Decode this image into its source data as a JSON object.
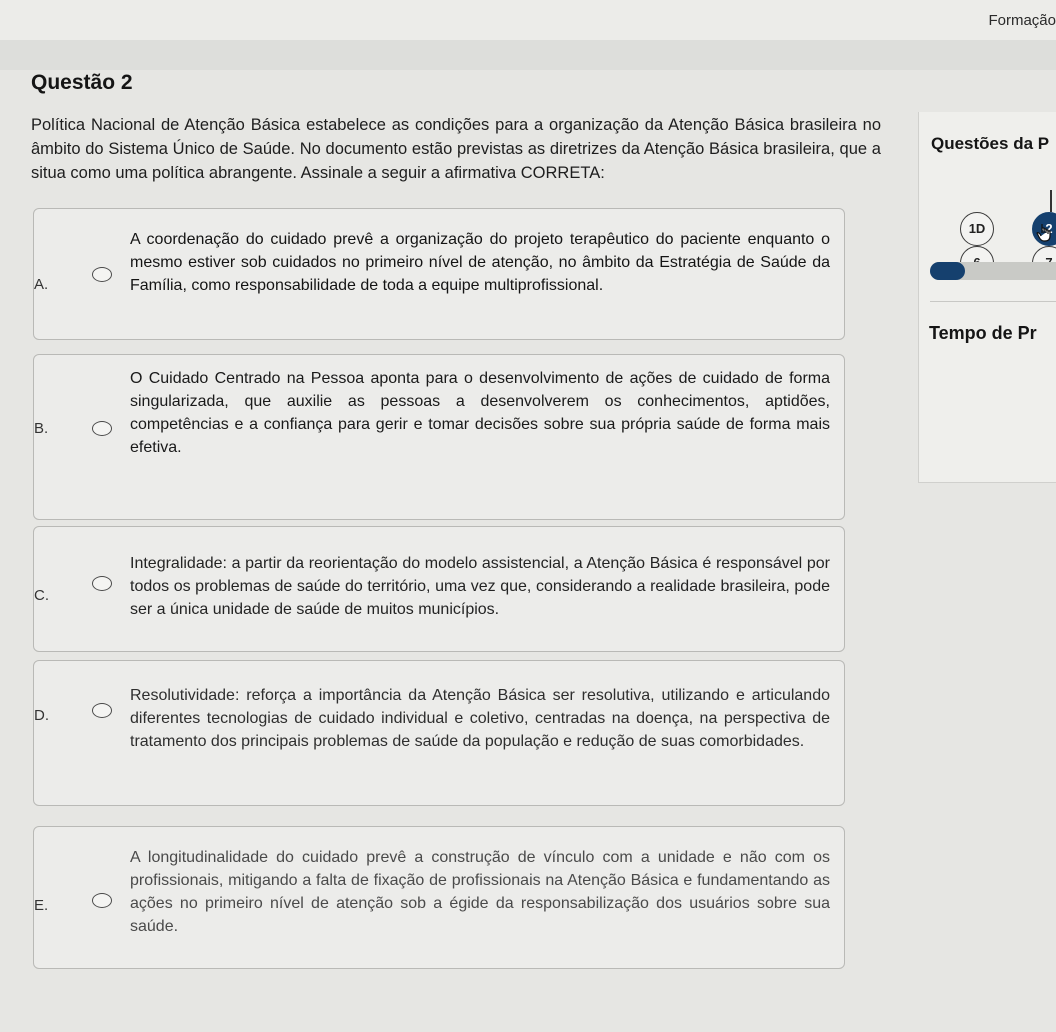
{
  "header": {
    "label": "Formação"
  },
  "question": {
    "title": "Questão 2",
    "text": "Política Nacional de Atenção Básica estabelece as condições para a organização da Atenção Básica brasileira no âmbito do Sistema Único de Saúde. No documento estão previstas as diretrizes da Atenção Básica brasileira, que a situa como uma política abrangente. Assinale a seguir a afirmativa CORRETA:"
  },
  "options": [
    {
      "letter": "A.",
      "text": "A coordenação do cuidado prevê a organização do projeto terapêutico do paciente enquanto o mesmo estiver sob cuidados no primeiro nível de atenção, no âmbito da Estratégia de Saúde da Família, como responsabilidade de toda a equipe multiprofissional."
    },
    {
      "letter": "B.",
      "text": "O Cuidado Centrado na Pessoa aponta para o desenvolvimento de ações de cuidado de forma singularizada, que auxilie as pessoas a desenvolverem os conhecimentos, aptidões, competências e a confiança para gerir e tomar decisões sobre sua própria saúde de forma mais efetiva."
    },
    {
      "letter": "C.",
      "text": "Integralidade: a partir da reorientação do modelo assistencial, a Atenção Básica é responsável por todos os problemas de saúde do território, uma vez que, considerando a realidade brasileira, pode ser a única unidade de saúde de muitos municípios."
    },
    {
      "letter": "D.",
      "text": "Resolutividade: reforça a importância da Atenção Básica ser resolutiva, utilizando e articulando diferentes tecnologias de cuidado individual e coletivo, centradas na doença, na perspectiva de tratamento dos principais problemas de saúde da população e redução de suas comorbidades."
    },
    {
      "letter": "E.",
      "text": "A longitudinalidade do cuidado prevê a construção de vínculo com a unidade e não com os profissionais, mitigando a falta de fixação de profissionais na Atenção Básica e fundamentando as ações no primeiro nível de atenção sob a égide da responsabilização dos usuários sobre sua saúde."
    }
  ],
  "sidebar": {
    "title": "Questões da P",
    "questions": [
      "1D",
      "2",
      "6",
      "7"
    ],
    "current": "2",
    "progress_fraction": 0.28,
    "time_label": "Tempo de Pr"
  },
  "colors": {
    "accent": "#15406e"
  }
}
